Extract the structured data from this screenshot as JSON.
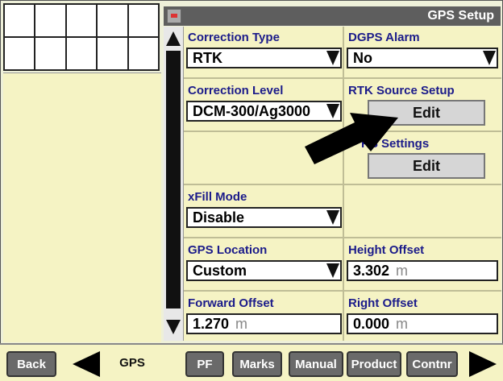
{
  "window": {
    "title": "GPS Setup"
  },
  "fields": {
    "correction_type": {
      "label": "Correction Type",
      "value": "RTK"
    },
    "dgps_alarm": {
      "label": "DGPS Alarm",
      "value": "No"
    },
    "correction_level": {
      "label": "Correction Level",
      "value": "DCM-300/Ag3000"
    },
    "rtk_source_setup": {
      "label": "RTK Source Setup",
      "button": "Edit"
    },
    "rs_settings": {
      "label": "RS Settings",
      "button": "Edit"
    },
    "xfill_mode": {
      "label": "xFill Mode",
      "value": "Disable"
    },
    "gps_location": {
      "label": "GPS Location",
      "value": "Custom"
    },
    "height_offset": {
      "label": "Height Offset",
      "value": "3.302",
      "unit": "m"
    },
    "forward_offset": {
      "label": "Forward Offset",
      "value": "1.270",
      "unit": "m"
    },
    "right_offset": {
      "label": "Right Offset",
      "value": "0.000",
      "unit": "m"
    }
  },
  "bottom_nav": {
    "back": "Back",
    "gps": "GPS",
    "pf": "PF",
    "marks": "Marks",
    "manual": "Manual",
    "product": "Product",
    "contnr": "Contnr"
  }
}
